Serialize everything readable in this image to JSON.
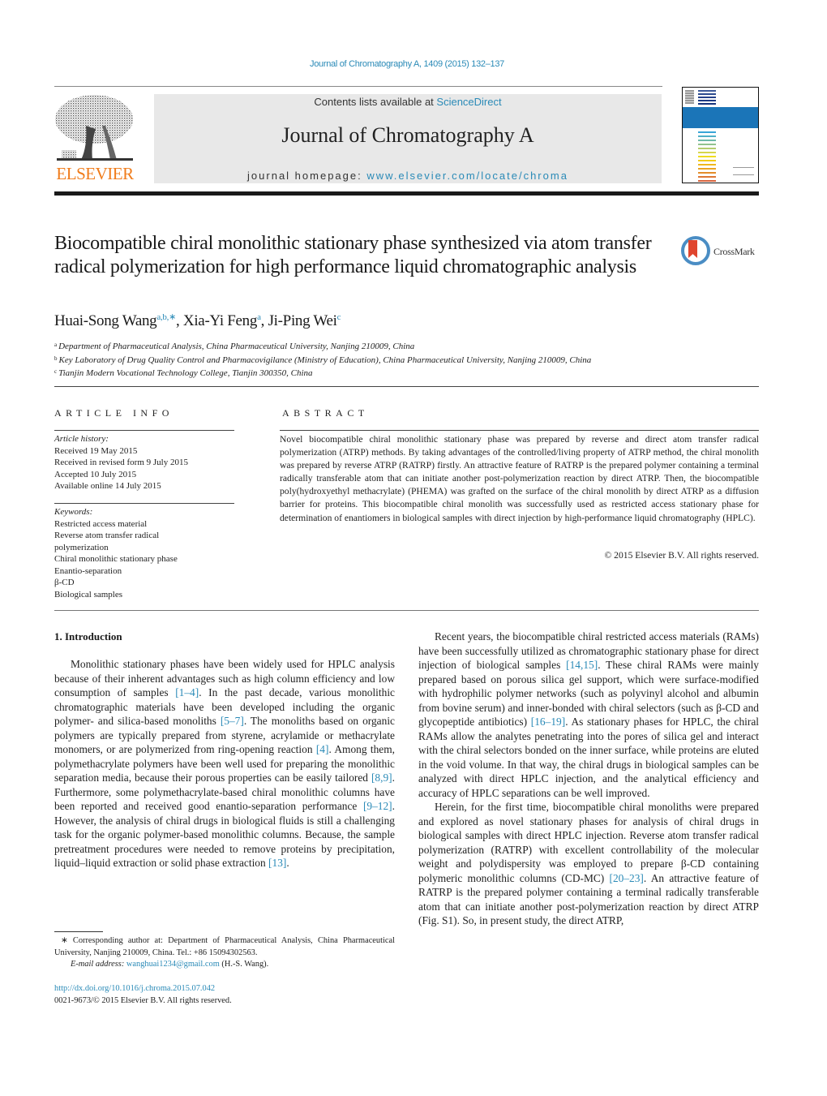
{
  "header": {
    "citation": "Journal of Chromatography A, 1409 (2015) 132–137",
    "contents_prefix": "Contents lists available at ",
    "contents_link": "ScienceDirect",
    "journal_title": "Journal of Chromatography A",
    "homepage_prefix": "journal homepage: ",
    "homepage_link": "www.elsevier.com/locate/chroma",
    "publisher_logo_text": "ELSEVIER",
    "crossmark_label": "CrossMark"
  },
  "colors": {
    "link": "#2a8ab7",
    "elsevier_orange": "#f07c1b",
    "masthead_bg": "#e8e8e8",
    "cover_band": "#1b75b8",
    "crossmark_red": "#e0452e",
    "crossmark_blue": "#4a8dc4"
  },
  "article": {
    "title": "Biocompatible chiral monolithic stationary phase synthesized via atom transfer radical polymerization for high performance liquid chromatographic analysis",
    "authors": [
      {
        "name": "Huai-Song Wang",
        "marks": "a,b,∗"
      },
      {
        "name": "Xia-Yi Feng",
        "marks": "a"
      },
      {
        "name": "Ji-Ping Wei",
        "marks": "c"
      }
    ],
    "affiliations": [
      {
        "mark": "a",
        "text": "Department of Pharmaceutical Analysis, China Pharmaceutical University, Nanjing 210009, China"
      },
      {
        "mark": "b",
        "text": "Key Laboratory of Drug Quality Control and Pharmacovigilance (Ministry of Education), China Pharmaceutical University, Nanjing 210009, China"
      },
      {
        "mark": "c",
        "text": "Tianjin Modern Vocational Technology College, Tianjin 300350, China"
      }
    ]
  },
  "article_info": {
    "heading": "ARTICLE INFO",
    "history_label": "Article history:",
    "history": [
      "Received 19 May 2015",
      "Received in revised form 9 July 2015",
      "Accepted 10 July 2015",
      "Available online 14 July 2015"
    ],
    "keywords_label": "Keywords:",
    "keywords": [
      "Restricted access material",
      "Reverse atom transfer radical polymerization",
      "Chiral monolithic stationary phase",
      "Enantio-separation",
      "β-CD",
      "Biological samples"
    ]
  },
  "abstract": {
    "heading": "ABSTRACT",
    "text": "Novel biocompatible chiral monolithic stationary phase was prepared by reverse and direct atom transfer radical polymerization (ATRP) methods. By taking advantages of the controlled/living property of ATRP method, the chiral monolith was prepared by reverse ATRP (RATRP) firstly. An attractive feature of RATRP is the prepared polymer containing a terminal radically transferable atom that can initiate another post-polymerization reaction by direct ATRP. Then, the biocompatible poly(hydroxyethyl methacrylate) (PHEMA) was grafted on the surface of the chiral monolith by direct ATRP as a diffusion barrier for proteins. This biocompatible chiral monolith was successfully used as restricted access stationary phase for determination of enantiomers in biological samples with direct injection by high-performance liquid chromatography (HPLC).",
    "copyright": "© 2015 Elsevier B.V. All rights reserved."
  },
  "body": {
    "section_heading": "1.  Introduction",
    "left_paragraph": [
      {
        "t": "Monolithic stationary phases have been widely used for HPLC analysis because of their inherent advantages such as high column efficiency and low consumption of samples "
      },
      {
        "ref": "[1–4]"
      },
      {
        "t": ". In the past decade, various monolithic chromatographic materials have been developed including the organic polymer- and silica-based monoliths "
      },
      {
        "ref": "[5–7]"
      },
      {
        "t": ". The monoliths based on organic polymers are typically prepared from styrene, acrylamide or methacrylate monomers, or are polymerized from ring-opening reaction "
      },
      {
        "ref": "[4]"
      },
      {
        "t": ". Among them, polymethacrylate polymers have been well used for preparing the monolithic separation media, because their porous properties can be easily tailored "
      },
      {
        "ref": "[8,9]"
      },
      {
        "t": ". Furthermore, some polymethacrylate-based chiral monolithic columns have been reported and received good enantio-separation performance "
      },
      {
        "ref": "[9–12]"
      },
      {
        "t": ". However, the analysis of chiral drugs in biological fluids is still a challenging task for the organic polymer-based monolithic columns. Because, the sample pretreatment procedures were needed to remove proteins by precipitation, liquid–liquid extraction or solid phase extraction "
      },
      {
        "ref": "[13]"
      },
      {
        "t": "."
      }
    ],
    "right_paragraph_1": [
      {
        "t": "Recent years, the biocompatible chiral restricted access materials (RAMs) have been successfully utilized as chromatographic stationary phase for direct injection of biological samples "
      },
      {
        "ref": "[14,15]"
      },
      {
        "t": ". These chiral RAMs were mainly prepared based on porous silica gel support, which were surface-modified with hydrophilic polymer networks (such as polyvinyl alcohol and albumin from bovine serum) and inner-bonded with chiral selectors (such as β-CD and glycopeptide antibiotics) "
      },
      {
        "ref": "[16–19]"
      },
      {
        "t": ". As stationary phases for HPLC, the chiral RAMs allow the analytes penetrating into the pores of silica gel and interact with the chiral selectors bonded on the inner surface, while proteins are eluted in the void volume. In that way, the chiral drugs in biological samples can be analyzed with direct HPLC injection, and the analytical efficiency and accuracy of HPLC separations can be well improved."
      }
    ],
    "right_paragraph_2": [
      {
        "t": "Herein, for the first time, biocompatible chiral monoliths were prepared and explored as novel stationary phases for analysis of chiral drugs in biological samples with direct HPLC injection. Reverse atom transfer radical polymerization (RATRP) with excellent controllability of the molecular weight and polydispersity was employed to prepare β-CD containing polymeric monolithic columns (CD-MC) "
      },
      {
        "ref": "[20–23]"
      },
      {
        "t": ". An attractive feature of RATRP is the prepared polymer containing a terminal radically transferable atom that can initiate another post-polymerization reaction by direct ATRP (Fig. S1). So, in present study, the direct ATRP,"
      }
    ]
  },
  "footnote": {
    "corresponding": "∗  Corresponding author at: Department of Pharmaceutical Analysis, China Pharmaceutical University, Nanjing 210009, China. Tel.: +86 15094302563.",
    "email_label": "E-mail address: ",
    "email": "wanghuai1234@gmail.com",
    "email_suffix": " (H.-S. Wang).",
    "doi": "http://dx.doi.org/10.1016/j.chroma.2015.07.042",
    "issn_line": "0021-9673/© 2015 Elsevier B.V. All rights reserved."
  }
}
